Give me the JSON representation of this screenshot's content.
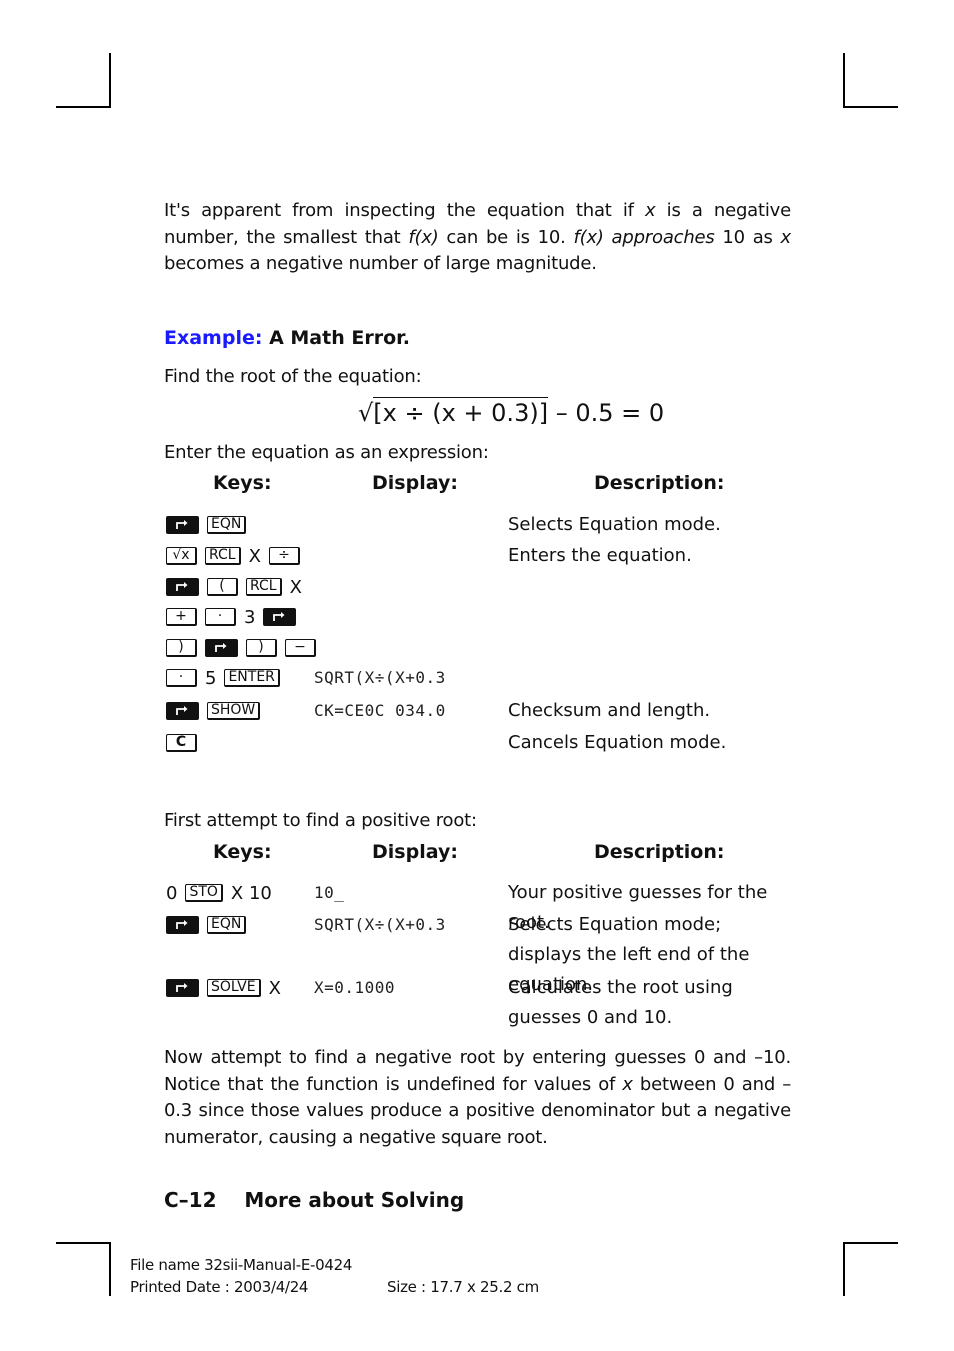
{
  "intro": {
    "parts": [
      {
        "t": "It's apparent from inspecting the equation that if ",
        "i": false
      },
      {
        "t": "x",
        "i": true
      },
      {
        "t": " is a negative number, the smallest that ",
        "i": false
      },
      {
        "t": "f(x)",
        "i": true
      },
      {
        "t": " can be is 10. ",
        "i": false
      },
      {
        "t": "f(x) approaches",
        "i": true
      },
      {
        "t": " 10 as ",
        "i": false
      },
      {
        "t": "x",
        "i": true
      },
      {
        "t": " becomes a negative number of large magnitude.",
        "i": false
      }
    ]
  },
  "example": {
    "label": "Example:",
    "title": "A Math Error."
  },
  "find_root_text": "Find the root of the equation:",
  "equation": {
    "radicand": "[x ÷ (x + 0.3)]",
    "rest": " – 0.5 = 0"
  },
  "enter_expression_text": "Enter the equation as an expression:",
  "table_headers": {
    "keys": "Keys:",
    "display": "Display:",
    "description": "Description:"
  },
  "table1": [
    {
      "keys": [
        {
          "k": "shift-key"
        },
        {
          "k": "EQN"
        }
      ],
      "display": "",
      "desc": "Selects Equation mode."
    },
    {
      "keys": [
        {
          "k": "√x"
        },
        {
          "k": "RCL"
        },
        {
          "t": "X"
        },
        {
          "k": "÷"
        }
      ],
      "display": "",
      "desc": "Enters the equation."
    },
    {
      "keys": [
        {
          "k": "shift-key"
        },
        {
          "k": "("
        },
        {
          "k": "RCL"
        },
        {
          "t": "X"
        }
      ],
      "display": "",
      "desc": ""
    },
    {
      "keys": [
        {
          "k": "+"
        },
        {
          "k": "·"
        },
        {
          "t": "3"
        },
        {
          "k": "shift-key"
        }
      ],
      "display": "",
      "desc": ""
    },
    {
      "keys": [
        {
          "k": ")"
        },
        {
          "k": "shift-key"
        },
        {
          "k": ")"
        },
        {
          "k": "−"
        }
      ],
      "display": "",
      "desc": ""
    },
    {
      "keys": [
        {
          "k": "·"
        },
        {
          "t": "5"
        },
        {
          "k": "ENTER"
        }
      ],
      "display": "SQRT(X÷(X+0.3",
      "desc": ""
    },
    {
      "keys": [
        {
          "k": "shift-key"
        },
        {
          "k": "SHOW"
        }
      ],
      "display": "CK=CE0C  034.0",
      "desc": "Checksum and length."
    },
    {
      "keys": [
        {
          "k": "C",
          "bold": true
        }
      ],
      "display": "",
      "desc": "Cancels Equation mode."
    }
  ],
  "first_attempt_text": "First attempt to find a positive root:",
  "table2": [
    {
      "keys": [
        {
          "t": "0"
        },
        {
          "k": "STO"
        },
        {
          "t": "X 10"
        }
      ],
      "display": "10_",
      "desc": "Your positive guesses for the root."
    },
    {
      "keys": [
        {
          "k": "shift-key"
        },
        {
          "k": "EQN"
        }
      ],
      "display": "SQRT(X÷(X+0.3",
      "desc": "Selects Equation mode; displays the left end of the equation."
    },
    {
      "keys": [
        {
          "k": "shift-key"
        },
        {
          "k": "SOLVE"
        },
        {
          "t": "X"
        }
      ],
      "display": "X=0.1000",
      "desc": "Calculates the root using guesses 0 and 10."
    }
  ],
  "outro": {
    "parts": [
      {
        "t": "Now attempt to find a negative root by entering guesses 0 and –10. Notice that the function is undefined for values of ",
        "i": false
      },
      {
        "t": "x",
        "i": true
      },
      {
        "t": " between 0 and –0.3 since those values produce a positive denominator but a negative numerator, causing a negative square root.",
        "i": false
      }
    ]
  },
  "chapter_footer": {
    "page": "C–12",
    "title": "More about Solving"
  },
  "print_info": {
    "file_name": "File name 32sii-Manual-E-0424",
    "printed_date": "Printed Date : 2003/4/24",
    "size": "Size : 17.7 x 25.2 cm"
  },
  "colors": {
    "example_label": "#1a1aff"
  }
}
